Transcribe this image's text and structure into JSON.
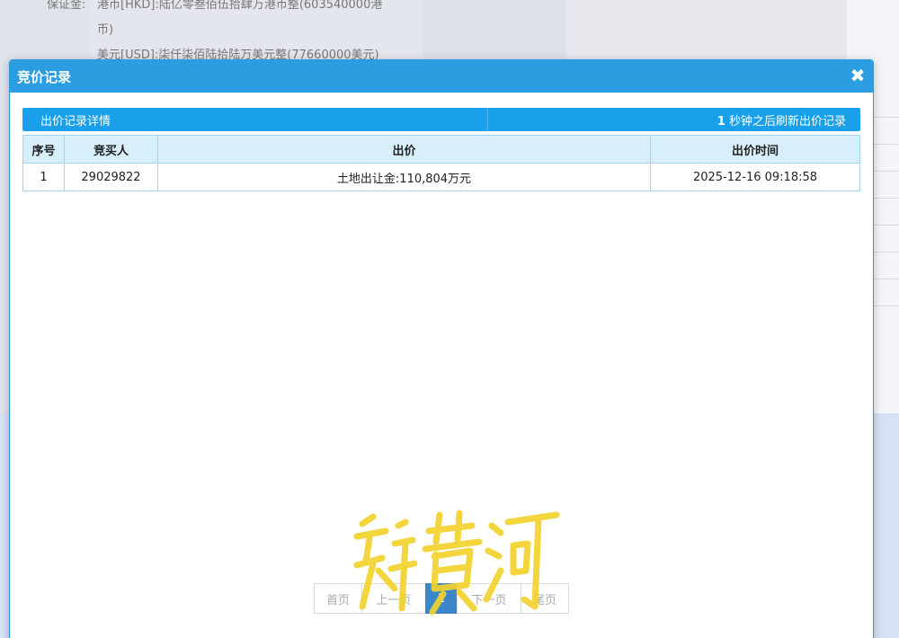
{
  "background": {
    "deposit_label": "保证金:",
    "hkd_line": "港币[HKD]:陆亿零叁佰伍拾肆万港币整(603540000港",
    "hkd_line_cont": "币)",
    "usd_line": "美元[USD]:柒仟柒佰陆拾陆万美元整(77660000美元)"
  },
  "modal": {
    "title": "竞价记录",
    "close_icon": "close-icon",
    "info_left": "出价记录详情",
    "refresh_count": "1",
    "refresh_text": "秒钟之后刷新出价记录"
  },
  "table": {
    "headers": [
      "序号",
      "竞买人",
      "出价",
      "出价时间"
    ],
    "rows": [
      {
        "index": "1",
        "bidder": "29029822",
        "price": "土地出让金:110,804万元",
        "time": "2025-12-16 09:18:58"
      }
    ]
  },
  "pager": {
    "first": "首页",
    "prev": "上一页",
    "current": "1",
    "next": "下一页",
    "last": "尾页"
  },
  "watermark_text": "新黄河",
  "colors": {
    "accent": "#2b9de0",
    "bar": "#1aa0ea",
    "watermark": "#f2d22e"
  }
}
